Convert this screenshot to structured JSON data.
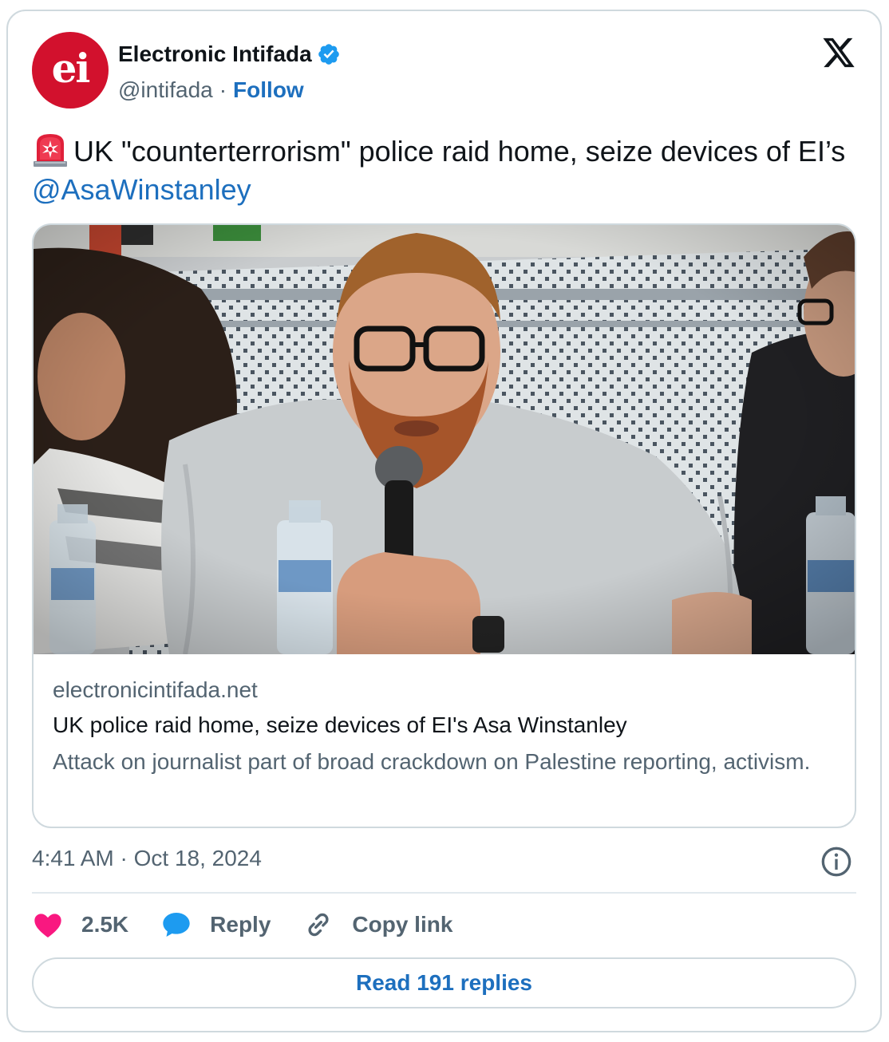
{
  "author": {
    "display_name": "Electronic Intifada",
    "handle": "@intifada",
    "separator": "·",
    "follow_label": "Follow",
    "avatar_text": "ei",
    "verified": true
  },
  "tweet": {
    "text_before": "UK \"counterterrorism\" police raid home, seize devices of EI’s ",
    "mention": "@AsaWinstanley"
  },
  "link_card": {
    "domain": "electronicintifada.net",
    "title": "UK police raid home, seize devices of EI's Asa Winstanley",
    "description": "Attack on journalist part of broad crackdown on Palestine reporting, activism."
  },
  "timestamp": "4:41 AM · Oct 18, 2024",
  "actions": {
    "like_count": "2.5K",
    "reply_label": "Reply",
    "copy_link_label": "Copy link"
  },
  "read_replies_label": "Read 191 replies",
  "icons": {
    "siren": "rotating-light-icon",
    "verified": "verified-badge-icon",
    "platform": "x-logo-icon",
    "info": "info-icon",
    "like": "heart-icon",
    "reply": "speech-bubble-icon",
    "copy": "link-icon"
  },
  "colors": {
    "accent": "#1d6fbe",
    "like": "#f91880",
    "reply": "#1d9bf0",
    "brand": "#d2112d",
    "text": "#0f1419",
    "muted": "#536471",
    "border": "#cfd9de"
  }
}
